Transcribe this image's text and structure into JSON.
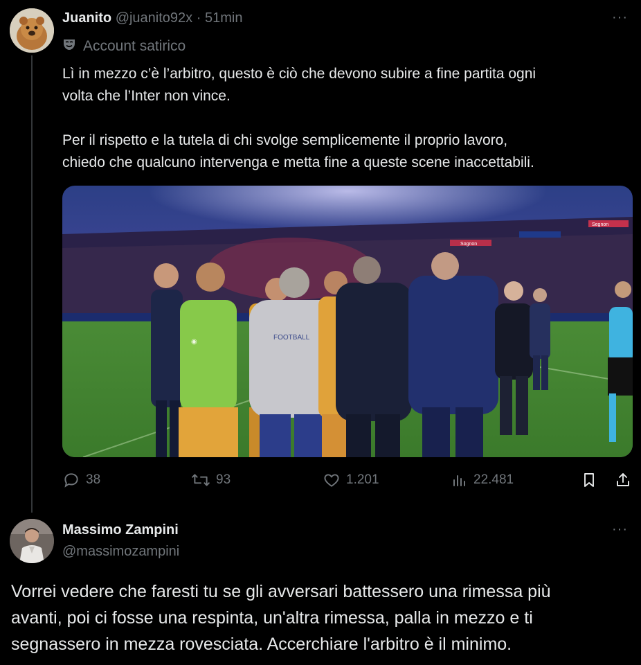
{
  "tweet1": {
    "display_name": "Juanito",
    "handle": "@juanito92x",
    "separator": "·",
    "time": "51min",
    "label_icon": "satire-mask-icon",
    "label": "Account satirico",
    "paragraph1_line1": "Lì in mezzo c’è l’arbitro, questo è ciò che devono subire a fine partita ogni",
    "paragraph1_line2": "volta che l’Inter non vince.",
    "paragraph2_line1": "Per il rispetto e la tutela di chi svolge semplicemente il proprio lavoro,",
    "paragraph2_line2": "chiedo che qualcuno intervenga e metta fine a queste scene inaccettabili.",
    "image_texts": [
      "Sognon",
      "Segnon",
      "FOOTBALL"
    ],
    "stats": {
      "replies": "38",
      "reposts": "93",
      "likes": "1.201",
      "views": "22.481"
    }
  },
  "tweet2": {
    "display_name": "Massimo Zampini",
    "handle": "@massimozampini",
    "line1": "Vorrei vedere che faresti tu se gli avversari battessero una rimessa più",
    "line2": "avanti, poi ci fosse una respinta, un'altra rimessa, palla in mezzo e ti",
    "line3": "segnassero in mezza rovesciata. Accerchiare l'arbitro è il minimo."
  },
  "ui": {
    "more_glyph": "···",
    "icons": [
      "reply-icon",
      "repost-icon",
      "like-icon",
      "views-icon",
      "bookmark-icon",
      "share-icon",
      "more-icon"
    ]
  },
  "colors": {
    "background": "#000000",
    "text": "#e7e9ea",
    "muted": "#71767b",
    "thread_line": "#333639"
  }
}
